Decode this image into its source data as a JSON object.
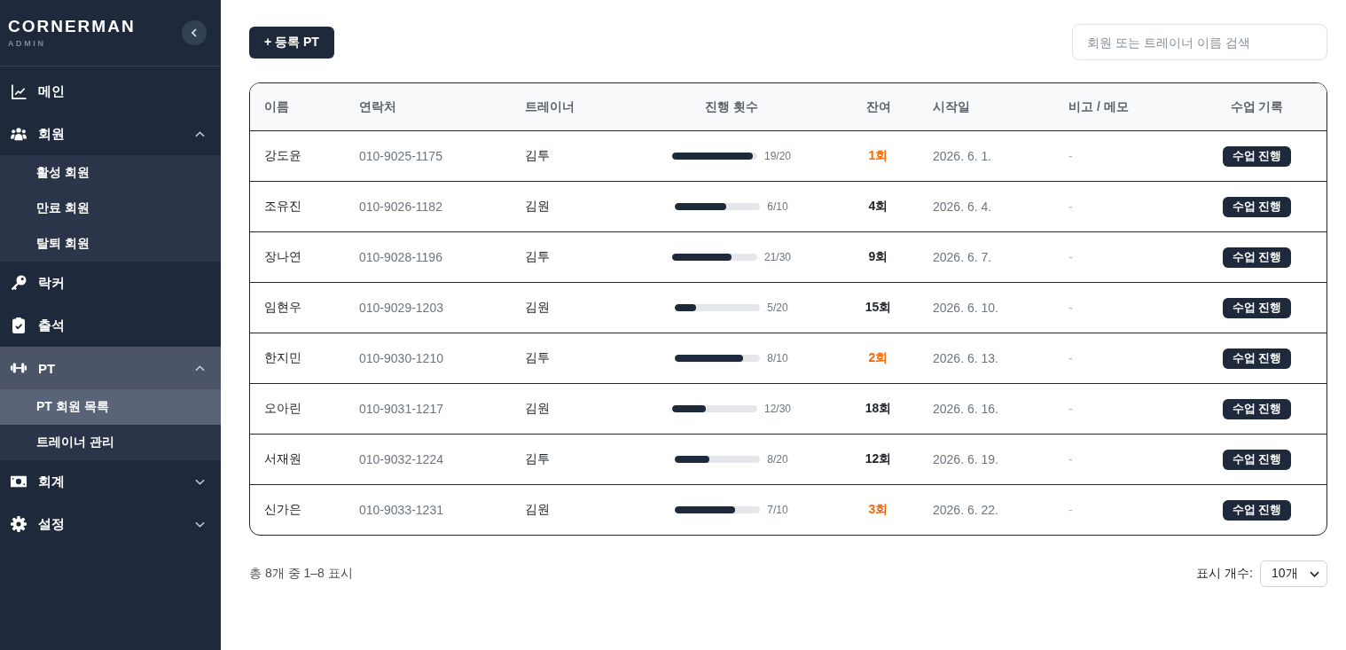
{
  "sidebar": {
    "logo": "CORNERMAN",
    "subtitle": "ADMIN",
    "items": [
      {
        "label": "메인",
        "selected": false
      },
      {
        "label": "회원",
        "selected": false,
        "expanded": true,
        "children": [
          {
            "label": "활성 회원",
            "selected": false
          },
          {
            "label": "만료 회원",
            "selected": false
          },
          {
            "label": "탈퇴 회원",
            "selected": false
          }
        ]
      },
      {
        "label": "락커",
        "selected": false
      },
      {
        "label": "출석",
        "selected": false
      },
      {
        "label": "PT",
        "selected": true,
        "expanded": true,
        "children": [
          {
            "label": "PT 회원 목록",
            "selected": true
          },
          {
            "label": "트레이너 관리",
            "selected": false
          }
        ]
      },
      {
        "label": "회계",
        "selected": false,
        "expanded": false
      },
      {
        "label": "설정",
        "selected": false,
        "expanded": false
      }
    ]
  },
  "toolbar": {
    "add_button": "+ 등록 PT",
    "search": {
      "placeholder": "회원 또는 트레이너 이름 검색"
    }
  },
  "table": {
    "columns": [
      "이름",
      "연락처",
      "트레이너",
      "진행 횟수",
      "잔여",
      "시작일",
      "비고 / 메모",
      "수업 기록"
    ],
    "rows": [
      {
        "name": "강도윤",
        "phone": "010-9025-1175",
        "trainer": "김투",
        "progress": {
          "level": 0.95,
          "reading": "19/20"
        },
        "remaining": "1회",
        "low": true,
        "start_date": "2026. 6. 1.",
        "memo": "-",
        "action": "수업 진행"
      },
      {
        "name": "조유진",
        "phone": "010-9026-1182",
        "trainer": "김원",
        "progress": {
          "level": 0.6,
          "reading": "6/10"
        },
        "remaining": "4회",
        "low": false,
        "start_date": "2026. 6. 4.",
        "memo": "-",
        "action": "수업 진행"
      },
      {
        "name": "장나연",
        "phone": "010-9028-1196",
        "trainer": "김투",
        "progress": {
          "level": 0.7,
          "reading": "21/30"
        },
        "remaining": "9회",
        "low": false,
        "start_date": "2026. 6. 7.",
        "memo": "-",
        "action": "수업 진행"
      },
      {
        "name": "임현우",
        "phone": "010-9029-1203",
        "trainer": "김원",
        "progress": {
          "level": 0.25,
          "reading": "5/20"
        },
        "remaining": "15회",
        "low": false,
        "start_date": "2026. 6. 10.",
        "memo": "-",
        "action": "수업 진행"
      },
      {
        "name": "한지민",
        "phone": "010-9030-1210",
        "trainer": "김투",
        "progress": {
          "level": 0.8,
          "reading": "8/10"
        },
        "remaining": "2회",
        "low": true,
        "start_date": "2026. 6. 13.",
        "memo": "-",
        "action": "수업 진행"
      },
      {
        "name": "오아린",
        "phone": "010-9031-1217",
        "trainer": "김원",
        "progress": {
          "level": 0.4,
          "reading": "12/30"
        },
        "remaining": "18회",
        "low": false,
        "start_date": "2026. 6. 16.",
        "memo": "-",
        "action": "수업 진행"
      },
      {
        "name": "서재원",
        "phone": "010-9032-1224",
        "trainer": "김투",
        "progress": {
          "level": 0.4,
          "reading": "8/20"
        },
        "remaining": "12회",
        "low": false,
        "start_date": "2026. 6. 19.",
        "memo": "-",
        "action": "수업 진행"
      },
      {
        "name": "신가은",
        "phone": "010-9033-1231",
        "trainer": "김원",
        "progress": {
          "level": 0.7,
          "reading": "7/10"
        },
        "remaining": "3회",
        "low": true,
        "start_date": "2026. 6. 22.",
        "memo": "-",
        "action": "수업 진행"
      }
    ]
  },
  "footer": {
    "summary": "총 8개 중 1–8 표시",
    "page_size_label": "표시 개수:",
    "page_size": "10개"
  }
}
